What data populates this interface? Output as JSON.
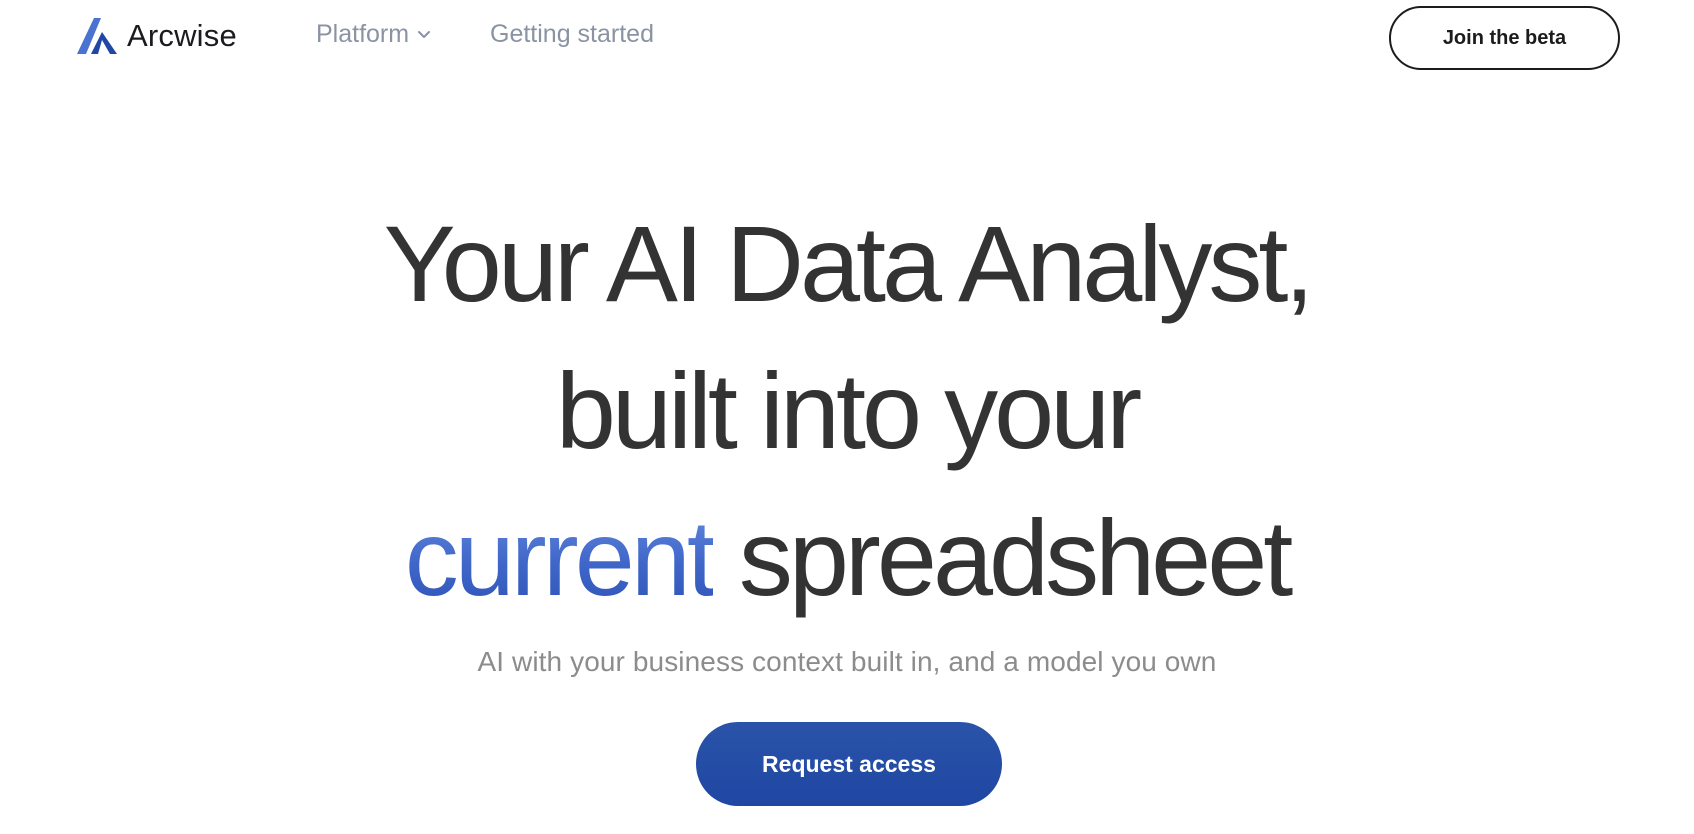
{
  "brand": {
    "name": "Arcwise",
    "logo_icon": "arcwise-logo-icon",
    "logo_colors": [
      "#3a66c7",
      "#1f47a3"
    ]
  },
  "nav": {
    "items": [
      {
        "label": "Platform",
        "has_dropdown": true,
        "icon": "chevron-down-icon"
      },
      {
        "label": "Getting started",
        "has_dropdown": false
      }
    ],
    "cta_label": "Join the beta"
  },
  "hero": {
    "title_line1": "Your AI Data Analyst,",
    "title_line2": "built into your",
    "title_accent": "current",
    "title_line3_rest": "spreadsheet",
    "subtitle": "AI with your business context built in, and a model you own",
    "cta_label": "Request access"
  },
  "colors": {
    "accent": "#3f66c9",
    "heading_text": "#333333",
    "muted_text": "#8c8c8c",
    "nav_text": "#8a93a3",
    "cta_background": "#1f47a3"
  }
}
